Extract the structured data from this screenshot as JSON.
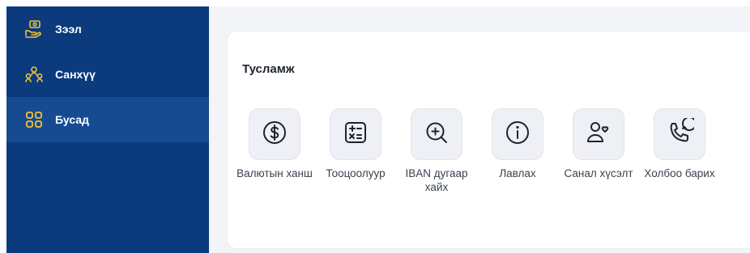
{
  "sidebar": {
    "items": [
      {
        "label": "Зээл",
        "icon": "loan-hand-icon",
        "active": false
      },
      {
        "label": "Санхүү",
        "icon": "finance-group-icon",
        "active": false
      },
      {
        "label": "Бусад",
        "icon": "grid-apps-icon",
        "active": true
      }
    ]
  },
  "main": {
    "card": {
      "title": "Тусламж",
      "tiles": [
        {
          "label": "Валютын ханш",
          "icon": "currency-dollar-icon"
        },
        {
          "label": "Тооцоолуур",
          "icon": "calculator-icon"
        },
        {
          "label": "IBAN дугаар хайх",
          "icon": "search-zoom-icon"
        },
        {
          "label": "Лавлах",
          "icon": "info-icon"
        },
        {
          "label": "Санал хүсэлт",
          "icon": "feedback-user-heart-icon"
        },
        {
          "label": "Холбоо барих",
          "icon": "phone-contact-icon"
        }
      ]
    }
  },
  "colors": {
    "sidebar_bg": "#0b3a7d",
    "sidebar_active": "#164b92",
    "sidebar_icon_accent": "#f4c430",
    "text_dark": "#1d2330"
  }
}
